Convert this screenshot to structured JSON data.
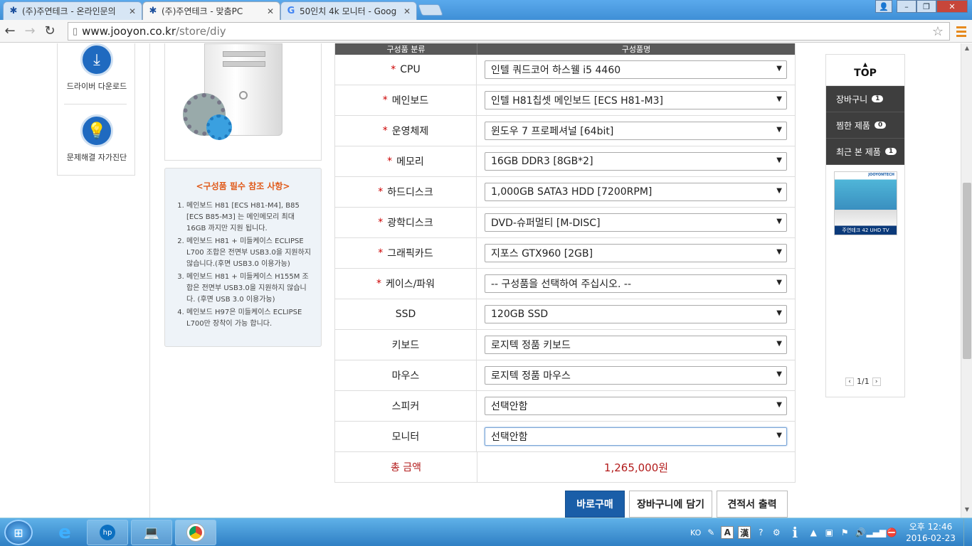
{
  "browser": {
    "tabs": [
      {
        "title": "(주)주연테크 - 온라인문의",
        "active": false
      },
      {
        "title": "(주)주연테크 - 맞춤PC",
        "active": true
      },
      {
        "title": "50인치 4k 모니터 - Goog",
        "active": false
      }
    ],
    "close_glyph": "✕",
    "url_domain": "www.jooyon.co.kr",
    "url_path": "/store/diy"
  },
  "left_nav": {
    "items": [
      {
        "label": "드라이버 다운로드",
        "icon": "download-icon"
      },
      {
        "label": "문제해결 자가진단",
        "icon": "lightbulb-icon"
      }
    ]
  },
  "notes": {
    "title": "<구성품 필수 참조 사항>",
    "items": [
      "메인보드 H81 [ECS H81-M4], B85 [ECS B85-M3] 는 메인메모리 최대 16GB 까지만 지원 됩니다.",
      "메인보드 H81 + 미들케이스 ECLIPSE L700 조합은 전면부 USB3.0을 지원하지 않습니다.(후면 USB3.0 이용가능)",
      "메인보드 H81 + 미들케이스 H155M 조합은 전면부 USB3.0을 지원하지 않습니다. (후면 USB 3.0 이용가능)",
      "메인보드 H97은 미들케이스 ECLIPSE L700만 장착이 가능 합니다."
    ]
  },
  "config_table": {
    "header": [
      "구성품 분류",
      "구성품명"
    ],
    "rows": [
      {
        "label": "CPU",
        "required": true,
        "value": "인텔 쿼드코어 하스웰 i5 4460"
      },
      {
        "label": "메인보드",
        "required": true,
        "value": "인텔 H81칩셋 메인보드 [ECS H81-M3]"
      },
      {
        "label": "운영체제",
        "required": true,
        "value": "윈도우 7 프로페셔널 [64bit]"
      },
      {
        "label": "메모리",
        "required": true,
        "value": "16GB DDR3 [8GB*2]"
      },
      {
        "label": "하드디스크",
        "required": true,
        "value": "1,000GB SATA3 HDD [7200RPM]"
      },
      {
        "label": "광학디스크",
        "required": true,
        "value": "DVD-슈퍼멀티 [M-DISC]"
      },
      {
        "label": "그래픽카드",
        "required": true,
        "value": "지포스 GTX960 [2GB]"
      },
      {
        "label": "케이스/파워",
        "required": true,
        "value": "-- 구성품을 선택하여 주십시오. --"
      },
      {
        "label": "SSD",
        "required": false,
        "value": "120GB SSD"
      },
      {
        "label": "키보드",
        "required": false,
        "value": "로지텍 정품 키보드"
      },
      {
        "label": "마우스",
        "required": false,
        "value": "로지텍 정품 마우스"
      },
      {
        "label": "스피커",
        "required": false,
        "value": "선택안함"
      },
      {
        "label": "모니터",
        "required": false,
        "value": "선택안함"
      }
    ],
    "required_mark": "*",
    "total_label": "총 금액",
    "total_value": "1,265,000원"
  },
  "actions": {
    "buy_now": "바로구매",
    "add_cart": "장바구니에 담기",
    "print_quote": "견적서 출력"
  },
  "right_panel": {
    "top_label": "TOP",
    "items": [
      {
        "label": "장바구니",
        "count": "1"
      },
      {
        "label": "찜한 제품",
        "count": "0"
      },
      {
        "label": "최근 본 제품",
        "count": "1"
      }
    ],
    "thumb_caption": "주연테크 42 UHD TV",
    "thumb_brand": "JOOYONTECH",
    "pager": "1/1"
  },
  "taskbar": {
    "lang": "KO",
    "ime_a": "A",
    "ime_han": "漢",
    "time": "오후 12:46",
    "date": "2016-02-23"
  },
  "colors": {
    "accent_blue": "#1a5ea8",
    "required_red": "#cc0000",
    "price_red": "#b21a1a",
    "note_orange": "#e05a1a"
  }
}
